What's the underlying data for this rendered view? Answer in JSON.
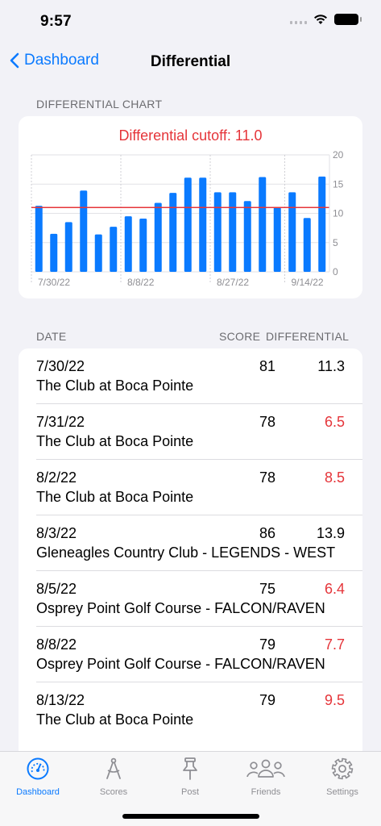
{
  "status": {
    "time": "9:57"
  },
  "nav": {
    "back_label": "Dashboard",
    "title": "Differential"
  },
  "chart_section": {
    "header": "DIFFERENTIAL CHART"
  },
  "chart_data": {
    "type": "bar",
    "title": "Differential cutoff: 11.0",
    "cutoff": 11.0,
    "ylim": [
      0,
      20
    ],
    "yticks": [
      0,
      5,
      10,
      15,
      20
    ],
    "xtick_labels": [
      {
        "label": "7/30/22",
        "index": 0
      },
      {
        "label": "8/8/22",
        "index": 6
      },
      {
        "label": "8/27/22",
        "index": 12
      },
      {
        "label": "9/14/22",
        "index": 17
      }
    ],
    "values": [
      11.3,
      6.5,
      8.5,
      13.9,
      6.4,
      7.7,
      9.5,
      9.1,
      11.8,
      13.5,
      16.1,
      16.1,
      13.6,
      13.6,
      12.1,
      16.2,
      11.0,
      13.6,
      9.2,
      16.3
    ],
    "bar_color": "#0a7aff",
    "cutoff_color": "#e5353a",
    "grid": true
  },
  "list_header": {
    "date": "DATE",
    "score": "SCORE",
    "differential": "DIFFERENTIAL"
  },
  "rounds": [
    {
      "date": "7/30/22",
      "course": "The Club at Boca Pointe",
      "score": "81",
      "differential": "11.3",
      "below_cutoff": false
    },
    {
      "date": "7/31/22",
      "course": "The Club at Boca Pointe",
      "score": "78",
      "differential": "6.5",
      "below_cutoff": true
    },
    {
      "date": "8/2/22",
      "course": "The Club at Boca Pointe",
      "score": "78",
      "differential": "8.5",
      "below_cutoff": true
    },
    {
      "date": "8/3/22",
      "course": "Gleneagles Country Club - LEGENDS - WEST",
      "score": "86",
      "differential": "13.9",
      "below_cutoff": false
    },
    {
      "date": "8/5/22",
      "course": "Osprey Point Golf Course - FALCON/RAVEN",
      "score": "75",
      "differential": "6.4",
      "below_cutoff": true
    },
    {
      "date": "8/8/22",
      "course": "Osprey Point Golf Course - FALCON/RAVEN",
      "score": "79",
      "differential": "7.7",
      "below_cutoff": true
    },
    {
      "date": "8/13/22",
      "course": "The Club at Boca Pointe",
      "score": "79",
      "differential": "9.5",
      "below_cutoff": true
    }
  ],
  "tabs": [
    {
      "label": "Dashboard",
      "icon": "gauge-icon",
      "active": true
    },
    {
      "label": "Scores",
      "icon": "compass-icon",
      "active": false
    },
    {
      "label": "Post",
      "icon": "pin-icon",
      "active": false
    },
    {
      "label": "Friends",
      "icon": "people-icon",
      "active": false
    },
    {
      "label": "Settings",
      "icon": "gear-icon",
      "active": false
    }
  ],
  "colors": {
    "accent": "#0a7aff",
    "red": "#e5353a",
    "background": "#f2f2f7"
  }
}
